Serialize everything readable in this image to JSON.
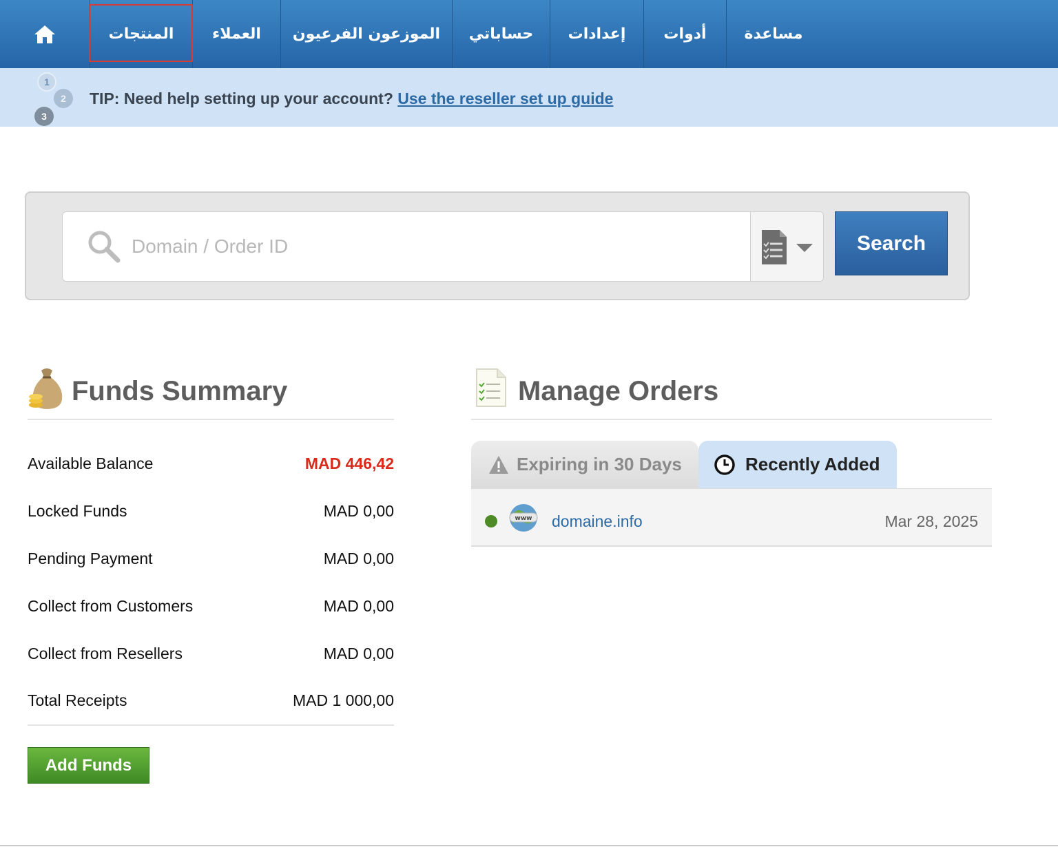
{
  "nav": {
    "items": [
      {
        "label": "المنتجات",
        "selected": true
      },
      {
        "label": "العملاء"
      },
      {
        "label": "الموزعون الفرعيون"
      },
      {
        "label": "حساباتي"
      },
      {
        "label": "إعدادات"
      },
      {
        "label": "أدوات"
      },
      {
        "label": "مساعدة"
      }
    ]
  },
  "tip": {
    "steps": [
      "1",
      "2",
      "3"
    ],
    "text": "TIP: Need help setting up your account? ",
    "link": "Use the reseller set up guide"
  },
  "search": {
    "placeholder": "Domain / Order ID",
    "button_label": "Search"
  },
  "funds": {
    "title": "Funds Summary",
    "rows": [
      {
        "label": "Available Balance",
        "value": "MAD 446,42"
      },
      {
        "label": "Locked Funds",
        "value": "MAD 0,00"
      },
      {
        "label": "Pending Payment",
        "value": "MAD 0,00"
      },
      {
        "label": "Collect from Customers",
        "value": "MAD 0,00"
      },
      {
        "label": "Collect from Resellers",
        "value": "MAD 0,00"
      },
      {
        "label": "Total Receipts",
        "value": "MAD 1 000,00"
      }
    ],
    "add_button": "Add Funds"
  },
  "orders": {
    "title": "Manage Orders",
    "tabs": [
      {
        "label": "Expiring in 30 Days",
        "icon": "warning-icon"
      },
      {
        "label": "Recently Added",
        "icon": "clock-icon",
        "active": true
      }
    ],
    "items": [
      {
        "domain": "domaine.info",
        "date": "Mar 28, 2025",
        "status_color": "#4e8a26"
      }
    ]
  },
  "colors": {
    "nav_blue": "#2f74b7",
    "tip_bg": "#cfe2f6",
    "negative": "#d92a1c",
    "add_green": "#4f9a2c",
    "link": "#2c6aa6"
  }
}
